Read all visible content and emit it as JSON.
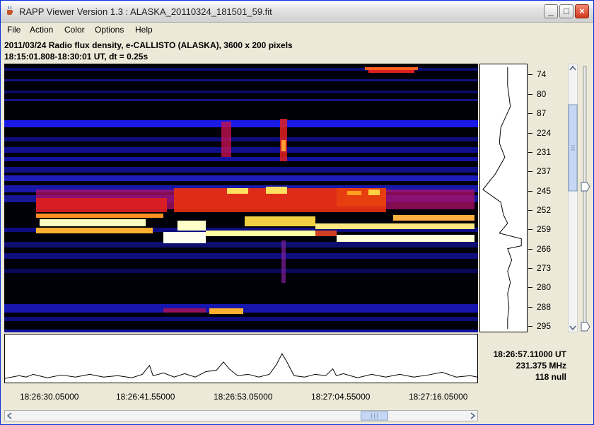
{
  "window": {
    "title": "RAPP Viewer Version 1.3 : ALASKA_20110324_181501_59.fit",
    "minimize_label": "_",
    "maximize_label": "□",
    "close_label": "×"
  },
  "menu": {
    "items": [
      "File",
      "Action",
      "Color",
      "Options",
      "Help"
    ]
  },
  "header": {
    "line1": "2011/03/24  Radio flux density, e-CALLISTO (ALASKA),  3600 x 200 pixels",
    "line2": "18:15:01.808-18:30:01 UT,  dt = 0.25s"
  },
  "freq_axis": {
    "labels": [
      "74",
      "80",
      "87",
      "224",
      "231",
      "237",
      "245",
      "252",
      "259",
      "266",
      "273",
      "280",
      "288",
      "295"
    ]
  },
  "time_axis": {
    "labels": [
      "18:26:30.05000",
      "18:26:41.55000",
      "18:26:53.05000",
      "18:27:04.55000",
      "18:27:16.05000"
    ]
  },
  "readout": {
    "time": "18:26:57.11000 UT",
    "freq": "231.375 MHz",
    "value": "118 null"
  },
  "colors": {
    "window_bg": "#ece9d8",
    "plot_bg": "#000000",
    "hot": "#ffffe0",
    "warm": "#ff3a00",
    "cool": "#1020e0"
  },
  "icons": {
    "app": "java-cup-icon",
    "scroll_up": "arrow-up-icon",
    "scroll_down": "arrow-down-icon",
    "scroll_left": "arrow-left-icon",
    "scroll_right": "arrow-right-icon",
    "freq_marker": "triangle-marker-icon"
  }
}
